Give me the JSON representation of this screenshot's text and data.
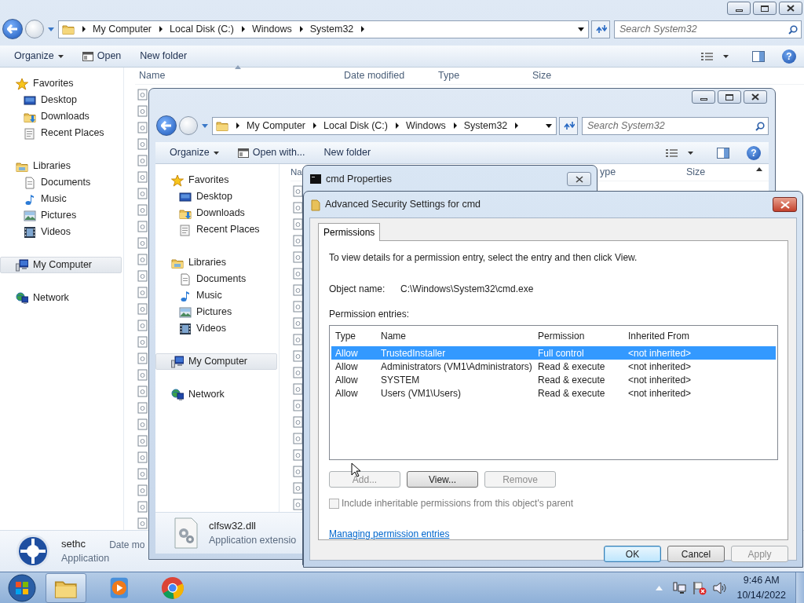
{
  "back_window": {
    "address": [
      "My Computer",
      "Local Disk (C:)",
      "Windows",
      "System32"
    ],
    "search": {
      "placeholder": "Search System32"
    },
    "toolbar": [
      {
        "label": "Organize",
        "kind": "dropdown"
      },
      {
        "label": "Open",
        "kind": "open"
      },
      {
        "label": "New folder",
        "kind": "plain"
      }
    ],
    "help": "?",
    "nav": [
      {
        "label": "Favorites",
        "kind": "star",
        "selected": false,
        "children": [
          {
            "label": "Desktop",
            "kind": "desktop",
            "selected": false
          },
          {
            "label": "Downloads",
            "kind": "downloads",
            "selected": false
          },
          {
            "label": "Recent Places",
            "kind": "recent",
            "selected": false
          }
        ]
      },
      {
        "label": "Libraries",
        "kind": "library",
        "selected": false,
        "children": [
          {
            "label": "Documents",
            "kind": "documents",
            "selected": false
          },
          {
            "label": "Music",
            "kind": "music",
            "selected": false
          },
          {
            "label": "Pictures",
            "kind": "pictures",
            "selected": false
          },
          {
            "label": "Videos",
            "kind": "videos",
            "selected": false
          }
        ]
      },
      {
        "label": "My Computer",
        "kind": "computer",
        "selected": true
      },
      {
        "label": "Network",
        "kind": "network",
        "selected": false
      }
    ],
    "columns": [
      {
        "label": "Name",
        "sorted": true
      },
      {
        "label": "Date modified",
        "sorted": false
      },
      {
        "label": "Type",
        "sorted": false
      },
      {
        "label": "Size",
        "sorted": false
      }
    ],
    "details": {
      "name": "sethc",
      "type": "Application",
      "column_3": "Date mo"
    }
  },
  "middle_window": {
    "address": [
      "My Computer",
      "Local Disk (C:)",
      "Windows",
      "System32"
    ],
    "search": {
      "placeholder": "Search System32"
    },
    "toolbar": [
      {
        "label": "Organize",
        "kind": "dropdown"
      },
      {
        "label": "Open with...",
        "kind": "open"
      },
      {
        "label": "New folder",
        "kind": "plain"
      }
    ],
    "help": "?",
    "nav": [
      {
        "label": "Favorites",
        "kind": "star",
        "selected": false,
        "children": [
          {
            "label": "Desktop",
            "kind": "desktop",
            "selected": false
          },
          {
            "label": "Downloads",
            "kind": "downloads",
            "selected": false
          },
          {
            "label": "Recent Places",
            "kind": "recent",
            "selected": false
          }
        ]
      },
      {
        "label": "Libraries",
        "kind": "library",
        "selected": false,
        "children": [
          {
            "label": "Documents",
            "kind": "documents",
            "selected": false
          },
          {
            "label": "Music",
            "kind": "music",
            "selected": false
          },
          {
            "label": "Pictures",
            "kind": "pictures",
            "selected": false
          },
          {
            "label": "Videos",
            "kind": "videos",
            "selected": false
          }
        ]
      },
      {
        "label": "My Computer",
        "kind": "computer",
        "selected": true
      },
      {
        "label": "Network",
        "kind": "network",
        "selected": false
      }
    ],
    "columns": [
      {
        "label": "Na",
        "sorted": false
      },
      {
        "label": "ype",
        "sorted": false
      },
      {
        "label": "Size",
        "sorted": false
      }
    ],
    "details": {
      "name": "clfsw32.dll",
      "type": "Application extensio"
    }
  },
  "properties_dialog": {
    "title": "cmd Properties"
  },
  "security_dialog": {
    "title": "Advanced Security Settings for cmd",
    "tabs": [
      {
        "label": "Permissions",
        "selected": true
      }
    ],
    "intro": "To view details for a permission entry, select the entry and then click View.",
    "object_name": {
      "label": "Object name:",
      "value": "C:\\Windows\\System32\\cmd.exe"
    },
    "entries_label": "Permission entries:",
    "table": {
      "columns": [
        "Type",
        "Name",
        "Permission",
        "Inherited From"
      ],
      "rows": [
        {
          "cells": [
            "Allow",
            "TrustedInstaller",
            "Full control",
            "<not inherited>"
          ],
          "selected": true
        },
        {
          "cells": [
            "Allow",
            "Administrators (VM1\\Administrators)",
            "Read & execute",
            "<not inherited>"
          ],
          "selected": false
        },
        {
          "cells": [
            "Allow",
            "SYSTEM",
            "Read & execute",
            "<not inherited>"
          ],
          "selected": false
        },
        {
          "cells": [
            "Allow",
            "Users (VM1\\Users)",
            "Read & execute",
            "<not inherited>"
          ],
          "selected": false
        }
      ]
    },
    "entry_buttons": [
      {
        "label": "Add...",
        "disabled": true
      },
      {
        "label": "View...",
        "disabled": false
      },
      {
        "label": "Remove",
        "disabled": true
      }
    ],
    "inherit_checkbox": {
      "label": "Include inheritable permissions from this object's parent",
      "checked": false,
      "disabled": true
    },
    "help_link": "Managing permission entries",
    "buttons": [
      {
        "label": "OK",
        "default": true,
        "disabled": false
      },
      {
        "label": "Cancel",
        "default": false,
        "disabled": false
      },
      {
        "label": "Apply",
        "default": false,
        "disabled": true
      }
    ]
  },
  "taskbar": {
    "apps": [
      {
        "kind": "explorer",
        "selected": true
      },
      {
        "kind": "media",
        "selected": false
      },
      {
        "kind": "browser",
        "selected": false
      }
    ],
    "time": "9:46 AM",
    "date": "10/14/2022"
  }
}
